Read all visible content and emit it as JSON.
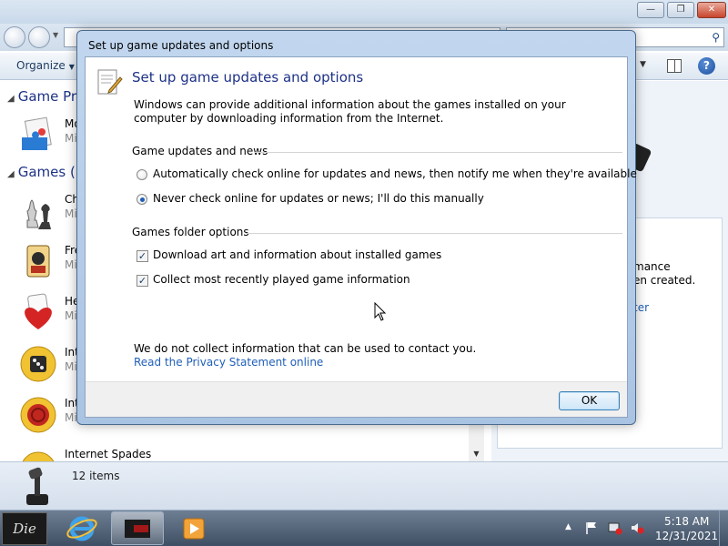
{
  "explorer": {
    "toolbar": {
      "organize_label": "Organize"
    },
    "groups": [
      {
        "label": "Game Pro"
      },
      {
        "label": "Games (1"
      }
    ],
    "items": [
      {
        "name": "Mo",
        "sub": "Mi"
      },
      {
        "name": "Ch",
        "sub": "Mi"
      },
      {
        "name": "Fre",
        "sub": "Mi"
      },
      {
        "name": "He",
        "sub": "Mi"
      },
      {
        "name": "Int",
        "sub": "Mi"
      },
      {
        "name": "Int",
        "sub": "Mi"
      },
      {
        "name": "Internet Spades",
        "sub": ""
      }
    ],
    "right_pane": {
      "text1": "mance",
      "text2": "en created.",
      "link": "ter"
    },
    "status": {
      "count": "12 items"
    }
  },
  "dialog": {
    "title": "Set up game updates and options",
    "heading": "Set up game updates and options",
    "intro": "Windows can provide additional information about the games installed on your computer by downloading information from the Internet.",
    "sections": {
      "updates_label": "Game updates and news",
      "folder_label": "Games folder options"
    },
    "radios": [
      {
        "label": "Automatically check online for updates and news, then notify me when they're available",
        "selected": false
      },
      {
        "label": "Never check online for updates or news; I'll do this manually",
        "selected": true
      }
    ],
    "checkboxes": [
      {
        "label": "Download art and information about installed games",
        "checked": true
      },
      {
        "label": "Collect most recently played game information",
        "checked": true
      }
    ],
    "privacy_text": "We do not collect information that can be used to contact you.",
    "privacy_link": "Read the Privacy Statement online",
    "ok_label": "OK"
  },
  "taskbar": {
    "start_label": "Die",
    "clock_time": "5:18 AM",
    "clock_date": "12/31/2021"
  }
}
